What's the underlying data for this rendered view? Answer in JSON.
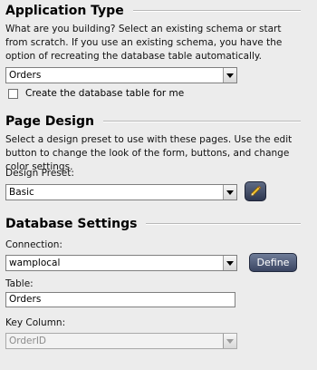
{
  "app_type": {
    "title": "Application Type",
    "description": "What are you building? Select an existing schema or start from scratch. If you use an existing schema, you have the option of recreating the database table automatically.",
    "schema_select_value": "Orders",
    "create_table_label": "Create the database table for me",
    "create_table_checked": false
  },
  "page_design": {
    "title": "Page Design",
    "description": "Select a design preset to use with these pages. Use the edit button to change the look of the form, buttons, and change color settings.",
    "preset_label": "Design Preset:",
    "preset_value": "Basic",
    "edit_icon": "pencil-icon"
  },
  "database_settings": {
    "title": "Database Settings",
    "connection_label": "Connection:",
    "connection_value": "wamplocal",
    "define_label": "Define",
    "table_label": "Table:",
    "table_value": "Orders",
    "key_column_label": "Key Column:",
    "key_column_value": "OrderID"
  }
}
